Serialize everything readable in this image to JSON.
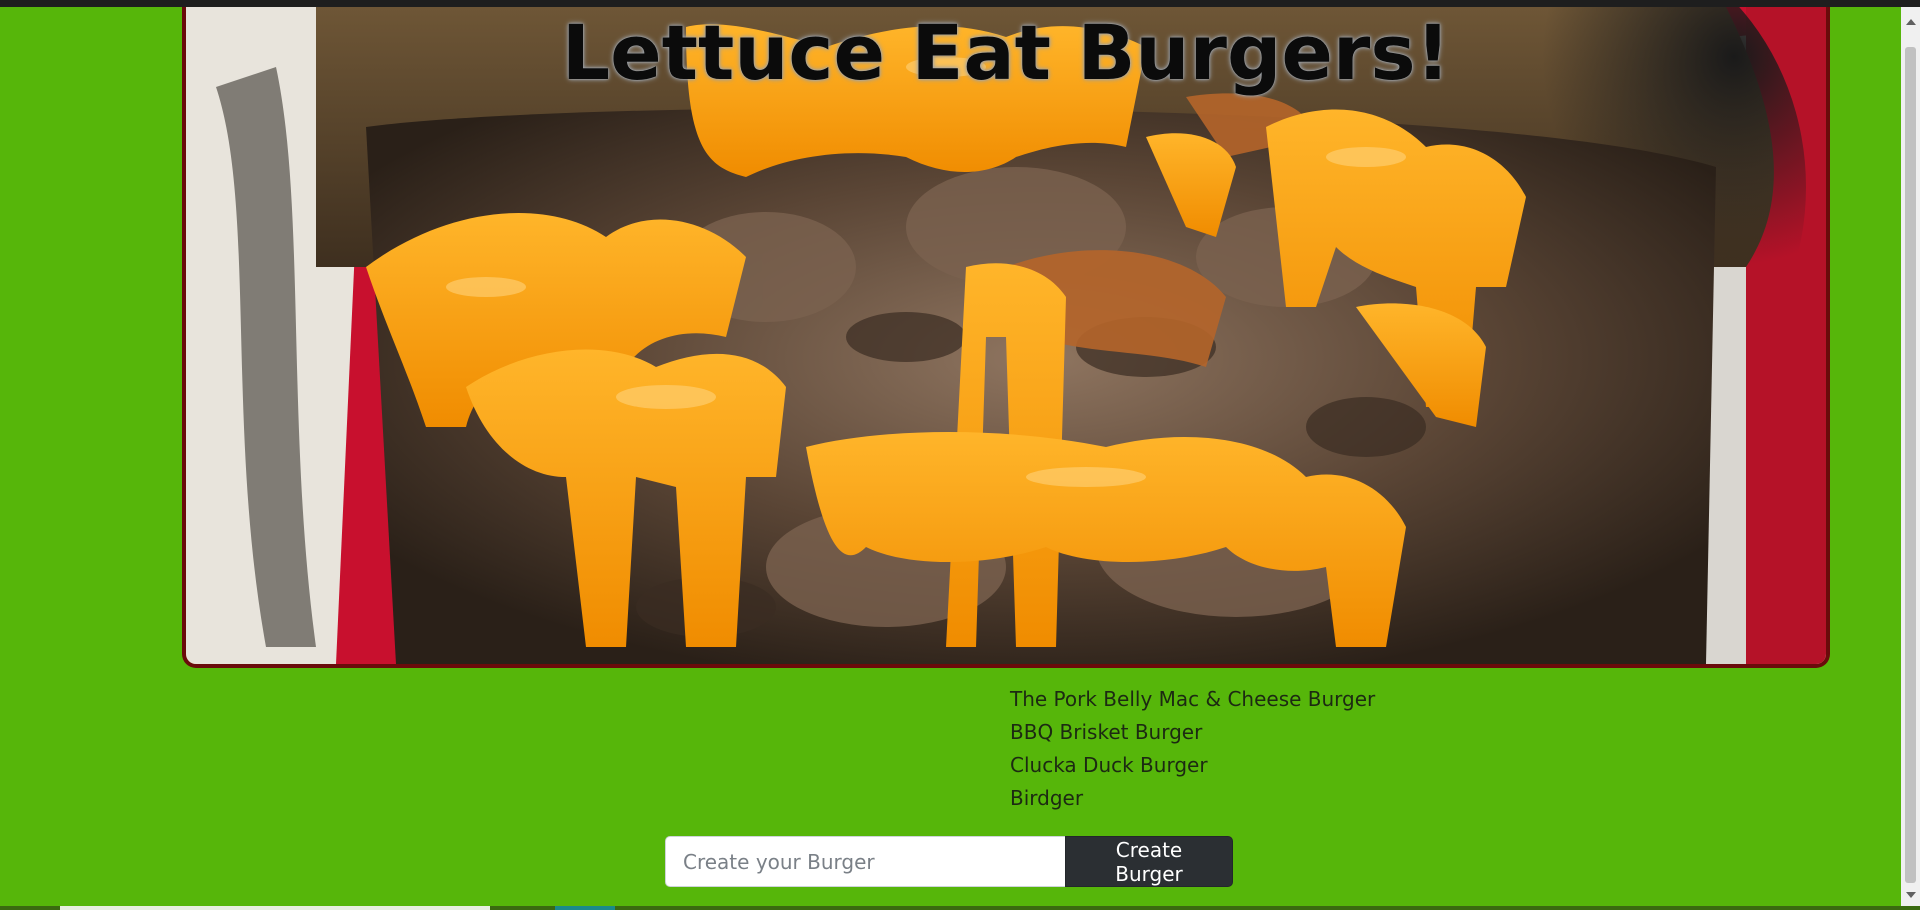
{
  "header": {
    "title": "Lettuce Eat Burgers!"
  },
  "hero": {
    "image": "cheeseburger-photo"
  },
  "burgers": {
    "items": [
      "The Pork Belly Mac & Cheese Burger",
      "BBQ Brisket Burger",
      "Clucka Duck Burger",
      "Birdger"
    ]
  },
  "form": {
    "placeholder": "Create your Burger",
    "value": "",
    "button_label": "Create Burger"
  },
  "colors": {
    "background": "#56b60a",
    "border": "#6a0b0b",
    "button": "#2b2f33",
    "cheese": "#f4a61e"
  }
}
